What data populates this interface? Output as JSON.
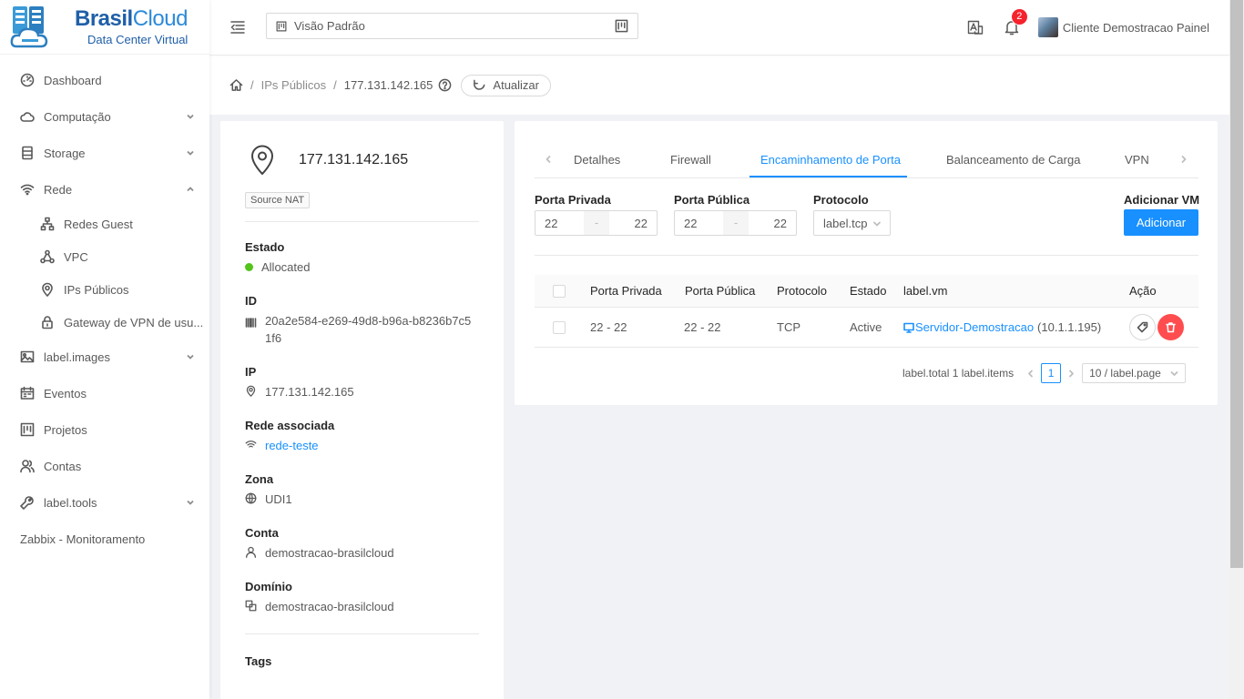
{
  "brand": {
    "name_a": "Brasil",
    "name_b": "Cloud",
    "subtitle": "Data Center Virtual"
  },
  "sidebar": {
    "items": [
      {
        "label": "Dashboard",
        "icon": "dashboard-icon"
      },
      {
        "label": "Computação",
        "icon": "cloud-icon",
        "expandable": true
      },
      {
        "label": "Storage",
        "icon": "storage-icon",
        "expandable": true
      },
      {
        "label": "Rede",
        "icon": "wifi-icon",
        "expandable": true,
        "expanded": true
      },
      {
        "label": "Redes Guest",
        "icon": "network-icon"
      },
      {
        "label": "VPC",
        "icon": "deployment-icon"
      },
      {
        "label": "IPs Públicos",
        "icon": "location-pin-icon"
      },
      {
        "label": "Gateway de VPN de usu...",
        "icon": "lock-icon"
      },
      {
        "label": "label.images",
        "icon": "image-icon",
        "expandable": true
      },
      {
        "label": "Eventos",
        "icon": "schedule-icon"
      },
      {
        "label": "Projetos",
        "icon": "project-icon"
      },
      {
        "label": "Contas",
        "icon": "team-icon"
      },
      {
        "label": "label.tools",
        "icon": "tool-icon",
        "expandable": true
      },
      {
        "label": "Zabbix - Monitoramento"
      }
    ]
  },
  "header": {
    "view_selector": "Visão Padrão",
    "notifications_count": "2",
    "user_name": "Cliente Demostracao Painel"
  },
  "breadcrumb": {
    "parent": "IPs Públicos",
    "current": "177.131.142.165",
    "refresh_label": "Atualizar"
  },
  "resource": {
    "ip_title": "177.131.142.165",
    "tag": "Source NAT",
    "fields": {
      "estado_label": "Estado",
      "estado_value": "Allocated",
      "id_label": "ID",
      "id_value": "20a2e584-e269-49d8-b96a-b8236b7c51f6",
      "ip_label": "IP",
      "ip_value": "177.131.142.165",
      "rede_label": "Rede associada",
      "rede_value": "rede-teste",
      "zona_label": "Zona",
      "zona_value": "UDI1",
      "conta_label": "Conta",
      "conta_value": "demostracao-brasilcloud",
      "dominio_label": "Domínio",
      "dominio_value": "demostracao-brasilcloud",
      "tags_label": "Tags"
    }
  },
  "tabs": [
    "Detalhes",
    "Firewall",
    "Encaminhamento de Porta",
    "Balanceamento de Carga",
    "VPN"
  ],
  "active_tab": "Encaminhamento de Porta",
  "form": {
    "private_label": "Porta Privada",
    "private_start": "22",
    "private_end": "22",
    "public_label": "Porta Pública",
    "public_start": "22",
    "public_end": "22",
    "range_sep": "-",
    "protocol_label": "Protocolo",
    "protocol_value": "label.tcp",
    "addvm_label": "Adicionar VM",
    "add_button": "Adicionar"
  },
  "table": {
    "headers": [
      "Porta Privada",
      "Porta Pública",
      "Protocolo",
      "Estado",
      "label.vm",
      "Ação"
    ],
    "rows": [
      {
        "private": "22 - 22",
        "public": "22 - 22",
        "protocol": "TCP",
        "state": "Active",
        "vm_name": "Servidor-Demostracao",
        "vm_ip": "(10.1.1.195)"
      }
    ]
  },
  "pagination": {
    "total_text": "label.total 1 label.items",
    "current_page": "1",
    "page_size": "10 / label.page"
  },
  "colors": {
    "primary": "#1890ff",
    "danger": "#ff4d4f",
    "success": "#52c41a"
  }
}
